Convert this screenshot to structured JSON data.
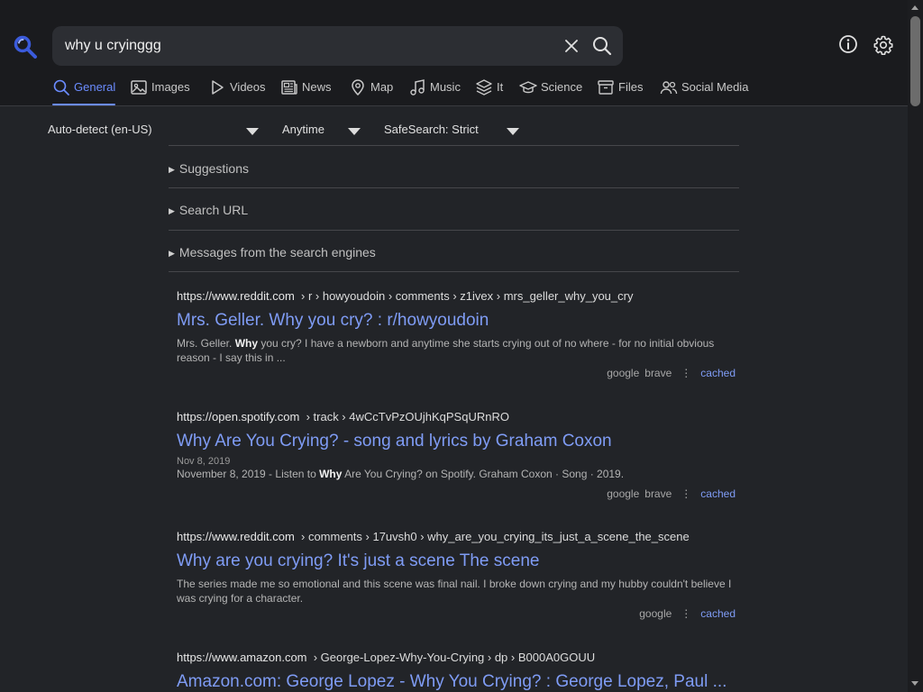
{
  "search": {
    "value": "why u cryinggg"
  },
  "tabs": [
    {
      "label": "General",
      "icon": "search-icon",
      "active": true
    },
    {
      "label": "Images",
      "icon": "image-icon"
    },
    {
      "label": "Videos",
      "icon": "play-icon"
    },
    {
      "label": "News",
      "icon": "newspaper-icon"
    },
    {
      "label": "Map",
      "icon": "map-pin-icon"
    },
    {
      "label": "Music",
      "icon": "music-note-icon"
    },
    {
      "label": "It",
      "icon": "layers-icon"
    },
    {
      "label": "Science",
      "icon": "graduation-cap-icon"
    },
    {
      "label": "Files",
      "icon": "archive-box-icon"
    },
    {
      "label": "Social Media",
      "icon": "people-icon"
    }
  ],
  "filters": {
    "language": "Auto-detect (en-US)",
    "time": "Anytime",
    "safesearch": "SafeSearch: Strict"
  },
  "sections": [
    {
      "label": "Suggestions"
    },
    {
      "label": "Search URL"
    },
    {
      "label": "Messages from the search engines"
    }
  ],
  "results": [
    {
      "domain": "https://www.reddit.com",
      "path": "› r › howyoudoin › comments › z1ivex › mrs_geller_why_you_cry",
      "title": "Mrs. Geller. Why you cry? : r/howyoudoin",
      "snippet_pre": "Mrs. Geller. ",
      "snippet_bold": "Why",
      "snippet_post": " you cry? I have a newborn and anytime she starts crying out of no where - for no initial obvious reason - I say this in ...",
      "engines": [
        "google",
        "brave"
      ],
      "cached": "cached"
    },
    {
      "domain": "https://open.spotify.com",
      "path": "› track › 4wCcTvPzOUjhKqPSqURnRO",
      "title": "Why Are You Crying? - song and lyrics by Graham Coxon",
      "date": "Nov 8, 2019",
      "snippet_pre": "November 8, 2019 - Listen to ",
      "snippet_bold": "Why",
      "snippet_post": " Are You Crying? on Spotify. Graham Coxon · Song · 2019.",
      "engines": [
        "google",
        "brave"
      ],
      "cached": "cached"
    },
    {
      "domain": "https://www.reddit.com",
      "path": "› comments › 17uvsh0 › why_are_you_crying_its_just_a_scene_the_scene",
      "title": "Why are you crying? It's just a scene The scene",
      "snippet": "The series made me so emotional and this scene was final nail. I broke down crying and my hubby couldn't believe I was crying for a character.",
      "engines": [
        "google"
      ],
      "cached": "cached"
    },
    {
      "domain": "https://www.amazon.com",
      "path": "› George-Lopez-Why-You-Crying › dp › B000A0GOUU",
      "title": "Amazon.com: George Lopez - Why You Crying? : George Lopez, Paul ..."
    }
  ],
  "colors": {
    "accent": "#6b8cff",
    "link": "#7f9cf5",
    "background": "#222428",
    "header": "#1a1b1e"
  }
}
